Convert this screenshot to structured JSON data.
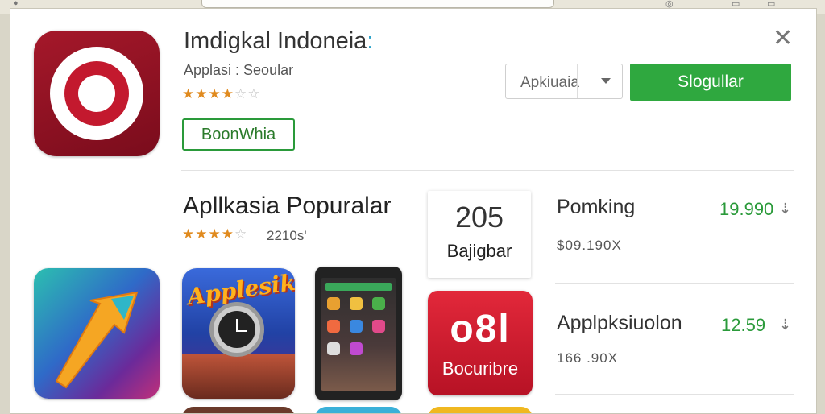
{
  "app": {
    "title": "Imdigkal Indoneia",
    "title_colon": ":",
    "subtitle": "Applasi : Seoular",
    "rating_stars": 3.5,
    "primary_outline_button": "BoonWhia",
    "select_value": "Apkiuaia",
    "green_button": "Slogullar",
    "close_icon": "close-icon",
    "icon": "target-icon"
  },
  "popular": {
    "title": "Apllkasia Popuralar",
    "rating_stars": 4,
    "rating_count": "2210s'",
    "rank_card": {
      "number": "205",
      "label": "Bajigbar"
    }
  },
  "list": [
    {
      "name": "Pomking",
      "price": "19.990",
      "meta": "$09.190X",
      "icon": "download-icon"
    },
    {
      "name": "Applpksiuolon",
      "price": "12.59",
      "meta": "166 .90X",
      "icon": "download-icon"
    }
  ],
  "thumbnails": {
    "t2_banner": "Applesik",
    "t4_big": "o8l",
    "t4_label": "Bocuribre"
  },
  "colors": {
    "accent_green": "#2fa83f",
    "brand_red": "#a5182a",
    "star": "#e08a1e"
  }
}
